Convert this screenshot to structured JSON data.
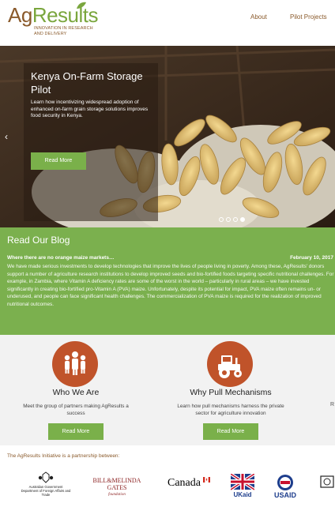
{
  "header": {
    "logo_ag": "Ag",
    "logo_results": "Results",
    "logo_tagline": "INNOVATION IN RESEARCH\nAND DELIVERY",
    "nav": [
      {
        "label": "About"
      },
      {
        "label": "Pilot Projects"
      }
    ]
  },
  "hero": {
    "title": "Kenya On-Farm Storage Pilot",
    "description": "Learn how incentivizing widespread adoption of enhanced on-farm grain storage solutions improves food security in Kenya.",
    "button_label": "Read More",
    "prev_arrow": "‹",
    "slide_count": 4,
    "active_slide": 4
  },
  "blog": {
    "heading": "Read Our Blog",
    "post_title": "Where there are no orange maize markets…",
    "post_date": "February 10, 2017",
    "post_body": "We have made serious investments to develop technologies that improve the lives of people living in poverty. Among these, AgResults' donors support a number of agriculture research institutions to develop improved seeds and bio-fortified foods targeting specific nutritional challenges. For example, in Zambia, where Vitamin A deficiency rates are some of the worst in the world – particularly in rural areas – we have invested significantly in creating bio-fortified pro-Vitamin A (PVA) maize. Unfortunately, despite its potential for impact, PVA maize often remains un- or underused, and people can face significant health challenges. The commercialization of PVA maize is required for the realization of improved nutritional outcomes."
  },
  "features": [
    {
      "icon": "people-group-icon",
      "title": "Who We Are",
      "description": "Meet the group of partners making AgResults a success",
      "button_label": "Read More"
    },
    {
      "icon": "tractor-icon",
      "title": "Why Pull Mechanisms",
      "description": "Learn how pull mechanisms harness the private sector for agriculture innovation",
      "button_label": "Read More"
    }
  ],
  "features_edge_text": "R",
  "partners": {
    "label": "The AgResults Initiative is a partnership between:",
    "australia": "Australian Government\nDepartment of Foreign Affairs and Trade",
    "gates": "BILL&MELINDA\nGATES",
    "gates_sub": "foundation",
    "canada": "Canada",
    "ukaid": "UKaid",
    "usaid": "USAID"
  },
  "colors": {
    "brand_green": "#7bb04e",
    "brand_brown": "#8a5a2b",
    "icon_orange": "#c0532a"
  }
}
